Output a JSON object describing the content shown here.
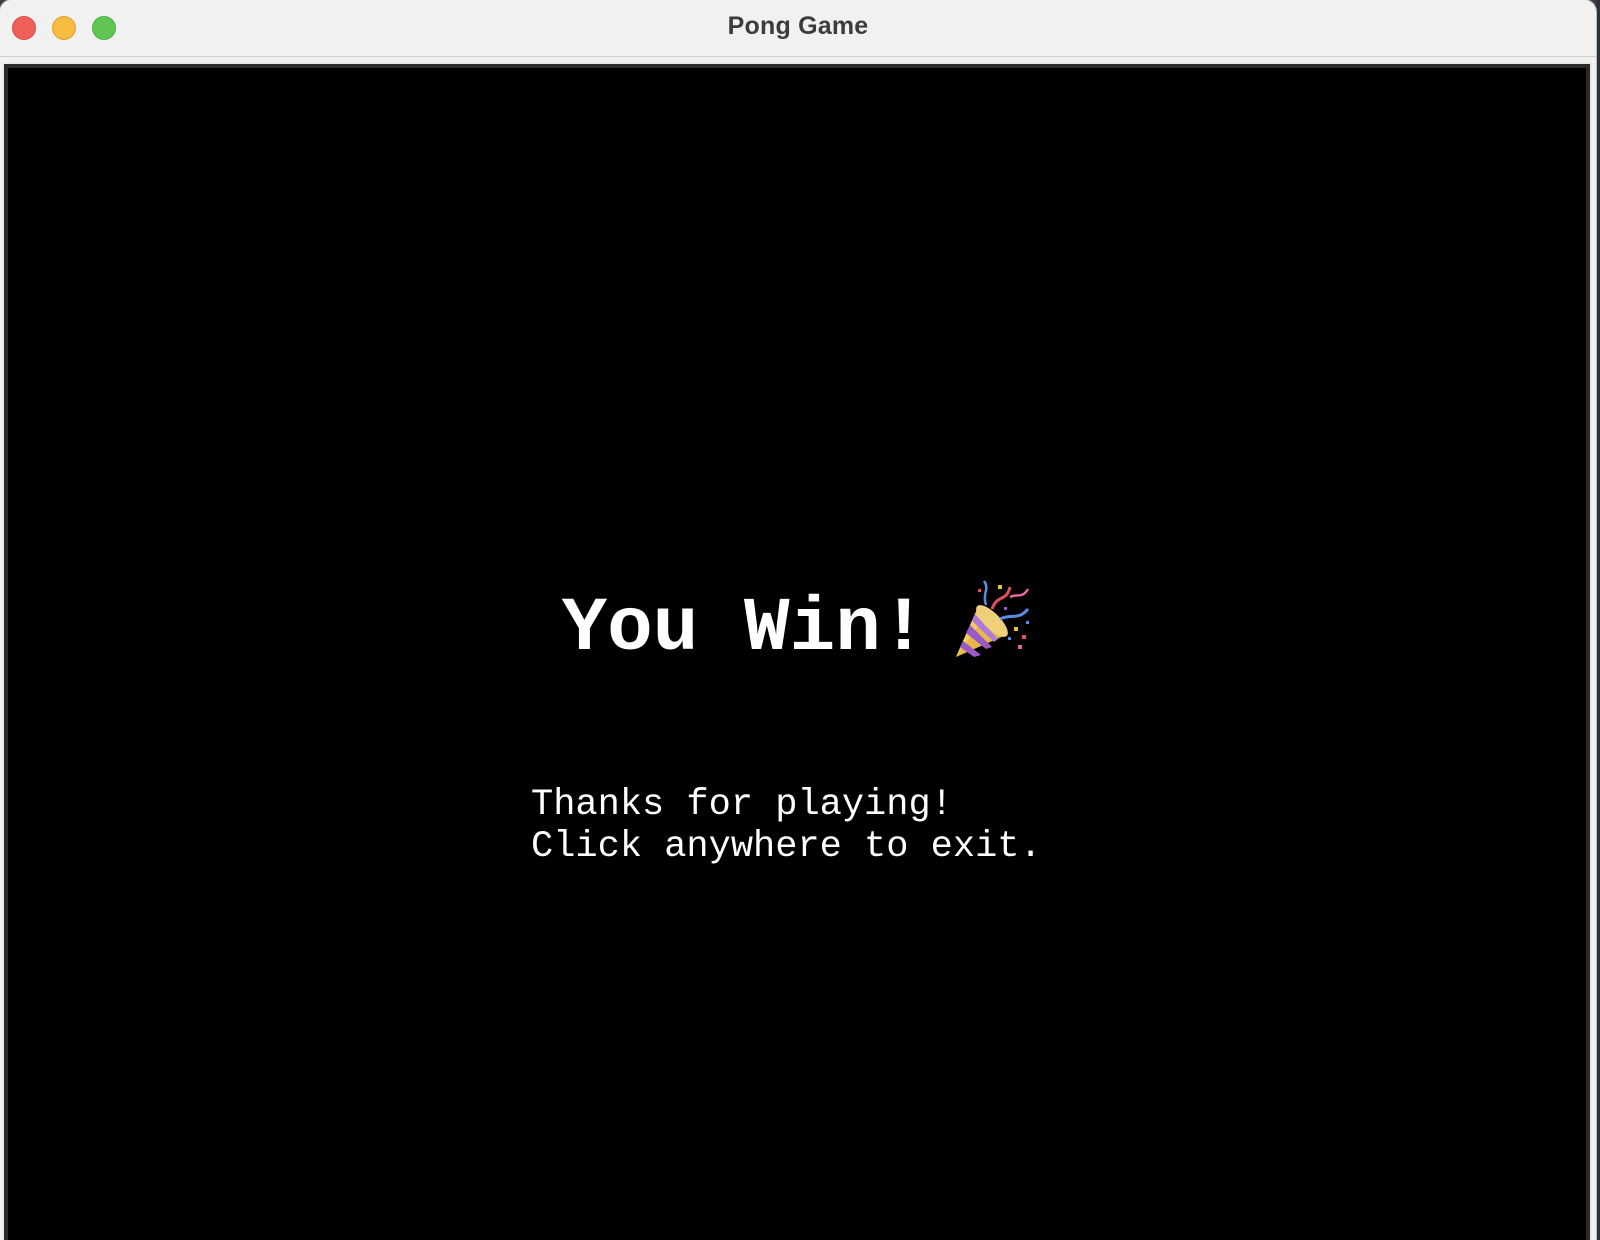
{
  "window": {
    "title": "Pong Game"
  },
  "game": {
    "win_text": "You Win!",
    "win_icon": "party-popper-icon",
    "message_line1": "Thanks for playing!",
    "message_line2": "Click anywhere to exit."
  },
  "colors": {
    "background": "#000000",
    "text": "#ffffff",
    "close": "#ee5f57",
    "minimize": "#f6bd3f",
    "zoom": "#60c553"
  }
}
